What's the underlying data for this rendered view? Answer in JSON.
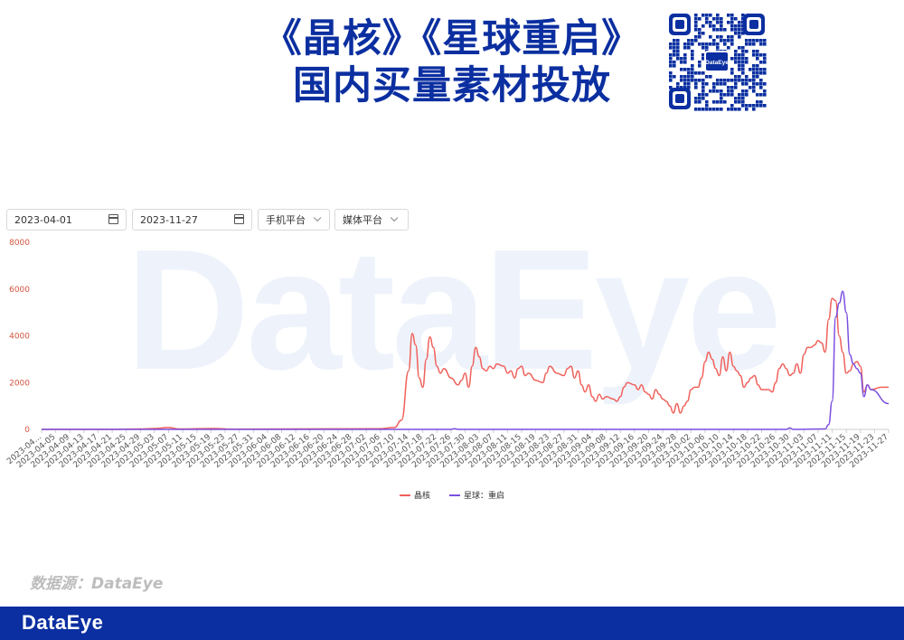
{
  "header": {
    "title_line1": "《晶核》《星球重启》",
    "title_line2": "国内买量素材投放",
    "qr_logo_text": "DataEye"
  },
  "filters": {
    "start_date": "2023-04-01",
    "end_date": "2023-11-27",
    "platform": "手机平台",
    "media": "媒体平台"
  },
  "watermark": "DataEye",
  "source_note": "数据源：DataEye",
  "footer": {
    "logo": "DataEye"
  },
  "colors": {
    "brand": "#0b2fa0",
    "series1": "#f0605a",
    "series2": "#7b4fe0",
    "axis_text": "#d4553e"
  },
  "chart_data": {
    "type": "line",
    "title": "",
    "ylim": [
      0,
      8000
    ],
    "yticks": [
      0,
      2000,
      4000,
      6000,
      8000
    ],
    "x_start": "2023-04-01",
    "x_end": "2023-11-27",
    "x_ticklabels": [
      "2023-04...",
      "2023-04-05",
      "2023-04-09",
      "2023-04-13",
      "2023-04-17",
      "2023-04-21",
      "2023-04-25",
      "2023-04-29",
      "2023-05-03",
      "2023-05-07",
      "2023-05-11",
      "2023-05-15",
      "2023-05-19",
      "2023-05-23",
      "2023-05-27",
      "2023-05-31",
      "2023-06-04",
      "2023-06-08",
      "2023-06-12",
      "2023-06-16",
      "2023-06-20",
      "2023-06-24",
      "2023-06-28",
      "2023-07-02",
      "2023-07-06",
      "2023-07-10",
      "2023-07-14",
      "2023-07-18",
      "2023-07-22",
      "2023-07-26",
      "2023-07-30",
      "2023-08-03",
      "2023-08-07",
      "2023-08-11",
      "2023-08-15",
      "2023-08-19",
      "2023-08-23",
      "2023-08-27",
      "2023-08-31",
      "2023-09-04",
      "2023-09-08",
      "2023-09-12",
      "2023-09-16",
      "2023-09-20",
      "2023-09-24",
      "2023-09-28",
      "2023-10-02",
      "2023-10-06",
      "2023-10-10",
      "2023-10-14",
      "2023-10-18",
      "2023-10-22",
      "2023-10-26",
      "2023-10-30",
      "2023-11-03",
      "2023-11-07",
      "2023-11-11",
      "2023-11-15",
      "2023-11-19",
      "2023-11-23",
      "2023-11-27"
    ],
    "legend_position": "bottom-center",
    "grid": false,
    "series": [
      {
        "name": "晶核",
        "points": [
          [
            "2023-04-01",
            0
          ],
          [
            "2023-04-20",
            0
          ],
          [
            "2023-04-29",
            20
          ],
          [
            "2023-05-03",
            40
          ],
          [
            "2023-05-07",
            80
          ],
          [
            "2023-05-10",
            20
          ],
          [
            "2023-05-20",
            40
          ],
          [
            "2023-05-25",
            10
          ],
          [
            "2023-06-10",
            20
          ],
          [
            "2023-07-06",
            30
          ],
          [
            "2023-07-10",
            80
          ],
          [
            "2023-07-12",
            400
          ],
          [
            "2023-07-14",
            2500
          ],
          [
            "2023-07-15",
            4100
          ],
          [
            "2023-07-16",
            3600
          ],
          [
            "2023-07-17",
            2200
          ],
          [
            "2023-07-18",
            1800
          ],
          [
            "2023-07-19",
            3000
          ],
          [
            "2023-07-20",
            3950
          ],
          [
            "2023-07-21",
            3500
          ],
          [
            "2023-07-22",
            2700
          ],
          [
            "2023-07-23",
            2400
          ],
          [
            "2023-07-24",
            2600
          ],
          [
            "2023-07-26",
            2200
          ],
          [
            "2023-07-28",
            1900
          ],
          [
            "2023-07-29",
            2100
          ],
          [
            "2023-07-30",
            2400
          ],
          [
            "2023-07-31",
            1800
          ],
          [
            "2023-08-01",
            2700
          ],
          [
            "2023-08-02",
            3500
          ],
          [
            "2023-08-03",
            3100
          ],
          [
            "2023-08-04",
            2600
          ],
          [
            "2023-08-05",
            2500
          ],
          [
            "2023-08-06",
            2700
          ],
          [
            "2023-08-07",
            2600
          ],
          [
            "2023-08-08",
            2800
          ],
          [
            "2023-08-10",
            2700
          ],
          [
            "2023-08-11",
            2400
          ],
          [
            "2023-08-12",
            2500
          ],
          [
            "2023-08-13",
            2200
          ],
          [
            "2023-08-14",
            2600
          ],
          [
            "2023-08-15",
            2700
          ],
          [
            "2023-08-16",
            2300
          ],
          [
            "2023-08-17",
            2400
          ],
          [
            "2023-08-19",
            2100
          ],
          [
            "2023-08-21",
            2000
          ],
          [
            "2023-08-22",
            2400
          ],
          [
            "2023-08-23",
            2700
          ],
          [
            "2023-08-25",
            2400
          ],
          [
            "2023-08-27",
            2300
          ],
          [
            "2023-08-28",
            2600
          ],
          [
            "2023-08-29",
            2700
          ],
          [
            "2023-08-30",
            2200
          ],
          [
            "2023-08-31",
            2500
          ],
          [
            "2023-09-01",
            1900
          ],
          [
            "2023-09-02",
            1600
          ],
          [
            "2023-09-03",
            1900
          ],
          [
            "2023-09-04",
            1400
          ],
          [
            "2023-09-05",
            1200
          ],
          [
            "2023-09-06",
            1500
          ],
          [
            "2023-09-07",
            1300
          ],
          [
            "2023-09-08",
            1400
          ],
          [
            "2023-09-10",
            1300
          ],
          [
            "2023-09-11",
            1200
          ],
          [
            "2023-09-12",
            1400
          ],
          [
            "2023-09-13",
            1800
          ],
          [
            "2023-09-14",
            2000
          ],
          [
            "2023-09-16",
            1900
          ],
          [
            "2023-09-17",
            1700
          ],
          [
            "2023-09-18",
            1900
          ],
          [
            "2023-09-19",
            1600
          ],
          [
            "2023-09-20",
            1500
          ],
          [
            "2023-09-21",
            1300
          ],
          [
            "2023-09-22",
            1700
          ],
          [
            "2023-09-23",
            1500
          ],
          [
            "2023-09-24",
            1300
          ],
          [
            "2023-09-25",
            1200
          ],
          [
            "2023-09-26",
            1000
          ],
          [
            "2023-09-27",
            700
          ],
          [
            "2023-09-28",
            1100
          ],
          [
            "2023-09-29",
            700
          ],
          [
            "2023-09-30",
            1000
          ],
          [
            "2023-10-01",
            1200
          ],
          [
            "2023-10-02",
            1700
          ],
          [
            "2023-10-03",
            1800
          ],
          [
            "2023-10-04",
            1800
          ],
          [
            "2023-10-05",
            2200
          ],
          [
            "2023-10-06",
            2900
          ],
          [
            "2023-10-07",
            3300
          ],
          [
            "2023-10-08",
            3000
          ],
          [
            "2023-10-09",
            2600
          ],
          [
            "2023-10-10",
            2300
          ],
          [
            "2023-10-11",
            3100
          ],
          [
            "2023-10-12",
            2500
          ],
          [
            "2023-10-13",
            3300
          ],
          [
            "2023-10-14",
            2700
          ],
          [
            "2023-10-15",
            2500
          ],
          [
            "2023-10-16",
            2300
          ],
          [
            "2023-10-17",
            1800
          ],
          [
            "2023-10-18",
            2000
          ],
          [
            "2023-10-19",
            2200
          ],
          [
            "2023-10-20",
            2300
          ],
          [
            "2023-10-21",
            1900
          ],
          [
            "2023-10-22",
            1700
          ],
          [
            "2023-10-24",
            1700
          ],
          [
            "2023-10-25",
            1600
          ],
          [
            "2023-10-26",
            2000
          ],
          [
            "2023-10-27",
            2600
          ],
          [
            "2023-10-28",
            2800
          ],
          [
            "2023-10-29",
            2600
          ],
          [
            "2023-10-30",
            2300
          ],
          [
            "2023-10-31",
            2400
          ],
          [
            "2023-11-01",
            2800
          ],
          [
            "2023-11-02",
            2400
          ],
          [
            "2023-11-03",
            3200
          ],
          [
            "2023-11-04",
            3500
          ],
          [
            "2023-11-05",
            3500
          ],
          [
            "2023-11-06",
            3600
          ],
          [
            "2023-11-07",
            3800
          ],
          [
            "2023-11-08",
            3700
          ],
          [
            "2023-11-09",
            3300
          ],
          [
            "2023-11-10",
            4700
          ],
          [
            "2023-11-11",
            5600
          ],
          [
            "2023-11-12",
            5500
          ],
          [
            "2023-11-13",
            4000
          ],
          [
            "2023-11-14",
            3300
          ],
          [
            "2023-11-15",
            2400
          ],
          [
            "2023-11-16",
            2500
          ],
          [
            "2023-11-17",
            2800
          ],
          [
            "2023-11-18",
            2900
          ],
          [
            "2023-11-19",
            2700
          ],
          [
            "2023-11-20",
            1600
          ],
          [
            "2023-11-21",
            1900
          ],
          [
            "2023-11-22",
            1700
          ],
          [
            "2023-11-25",
            1800
          ],
          [
            "2023-11-27",
            1800
          ]
        ]
      },
      {
        "name": "星球：重启",
        "points": [
          [
            "2023-04-01",
            0
          ],
          [
            "2023-07-26",
            0
          ],
          [
            "2023-07-27",
            30
          ],
          [
            "2023-07-28",
            0
          ],
          [
            "2023-10-29",
            0
          ],
          [
            "2023-10-30",
            60
          ],
          [
            "2023-10-31",
            0
          ],
          [
            "2023-11-09",
            20
          ],
          [
            "2023-11-10",
            200
          ],
          [
            "2023-11-11",
            1200
          ],
          [
            "2023-11-12",
            4800
          ],
          [
            "2023-11-13",
            5400
          ],
          [
            "2023-11-14",
            5900
          ],
          [
            "2023-11-15",
            5000
          ],
          [
            "2023-11-16",
            3200
          ],
          [
            "2023-11-17",
            2800
          ],
          [
            "2023-11-18",
            2600
          ],
          [
            "2023-11-19",
            2400
          ],
          [
            "2023-11-20",
            1400
          ],
          [
            "2023-11-21",
            1900
          ],
          [
            "2023-11-22",
            1700
          ],
          [
            "2023-11-27",
            1100
          ]
        ]
      }
    ]
  }
}
